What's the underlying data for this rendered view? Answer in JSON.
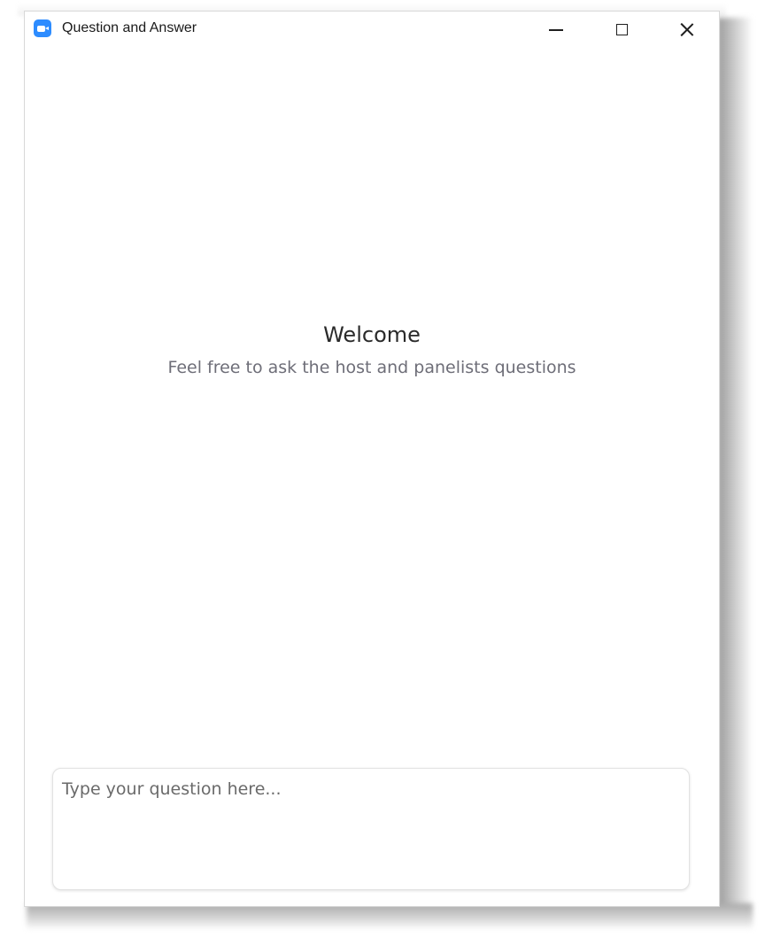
{
  "window": {
    "title": "Question and Answer",
    "icon": "zoom-app-icon",
    "accent": "#2d8cff",
    "controls": {
      "minimize_icon": "minimize-icon",
      "maximize_icon": "maximize-icon",
      "close_icon": "close-icon"
    }
  },
  "main": {
    "welcome_title": "Welcome",
    "welcome_subtitle": "Feel free to ask the host and panelists questions"
  },
  "question_input": {
    "placeholder": "Type your question here...",
    "value": ""
  }
}
